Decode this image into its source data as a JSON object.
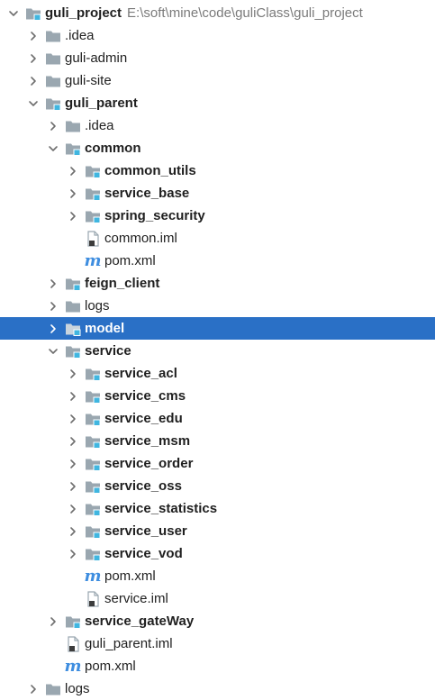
{
  "tree": [
    {
      "label": "guli_project",
      "path": "E:\\soft\\mine\\code\\guliClass\\guli_project",
      "icon": "module-folder-icon",
      "bold": true,
      "expanded": true,
      "depth": 0,
      "arrow": "down"
    },
    {
      "label": ".idea",
      "icon": "folder-icon",
      "bold": false,
      "depth": 1,
      "arrow": "right"
    },
    {
      "label": "guli-admin",
      "icon": "folder-icon",
      "bold": false,
      "depth": 1,
      "arrow": "right"
    },
    {
      "label": "guli-site",
      "icon": "folder-icon",
      "bold": false,
      "depth": 1,
      "arrow": "right"
    },
    {
      "label": "guli_parent",
      "icon": "module-folder-icon",
      "bold": true,
      "depth": 1,
      "arrow": "down"
    },
    {
      "label": ".idea",
      "icon": "folder-icon",
      "bold": false,
      "depth": 2,
      "arrow": "right"
    },
    {
      "label": "common",
      "icon": "module-folder-icon",
      "bold": true,
      "depth": 2,
      "arrow": "down"
    },
    {
      "label": "common_utils",
      "icon": "module-folder-icon",
      "bold": true,
      "depth": 3,
      "arrow": "right"
    },
    {
      "label": "service_base",
      "icon": "module-folder-icon",
      "bold": true,
      "depth": 3,
      "arrow": "right"
    },
    {
      "label": "spring_security",
      "icon": "module-folder-icon",
      "bold": true,
      "depth": 3,
      "arrow": "right"
    },
    {
      "label": "common.iml",
      "icon": "iml-file-icon",
      "bold": false,
      "depth": 3,
      "arrow": "none"
    },
    {
      "label": "pom.xml",
      "icon": "maven-icon",
      "bold": false,
      "depth": 3,
      "arrow": "none"
    },
    {
      "label": "feign_client",
      "icon": "module-folder-icon",
      "bold": true,
      "depth": 2,
      "arrow": "right"
    },
    {
      "label": "logs",
      "icon": "folder-icon",
      "bold": false,
      "depth": 2,
      "arrow": "right"
    },
    {
      "label": "model",
      "icon": "module-folder-icon",
      "bold": true,
      "depth": 2,
      "arrow": "right",
      "selected": true
    },
    {
      "label": "service",
      "icon": "module-folder-icon",
      "bold": true,
      "depth": 2,
      "arrow": "down"
    },
    {
      "label": "service_acl",
      "icon": "module-folder-icon",
      "bold": true,
      "depth": 3,
      "arrow": "right"
    },
    {
      "label": "service_cms",
      "icon": "module-folder-icon",
      "bold": true,
      "depth": 3,
      "arrow": "right"
    },
    {
      "label": "service_edu",
      "icon": "module-folder-icon",
      "bold": true,
      "depth": 3,
      "arrow": "right"
    },
    {
      "label": "service_msm",
      "icon": "module-folder-icon",
      "bold": true,
      "depth": 3,
      "arrow": "right"
    },
    {
      "label": "service_order",
      "icon": "module-folder-icon",
      "bold": true,
      "depth": 3,
      "arrow": "right"
    },
    {
      "label": "service_oss",
      "icon": "module-folder-icon",
      "bold": true,
      "depth": 3,
      "arrow": "right"
    },
    {
      "label": "service_statistics",
      "icon": "module-folder-icon",
      "bold": true,
      "depth": 3,
      "arrow": "right"
    },
    {
      "label": "service_user",
      "icon": "module-folder-icon",
      "bold": true,
      "depth": 3,
      "arrow": "right"
    },
    {
      "label": "service_vod",
      "icon": "module-folder-icon",
      "bold": true,
      "depth": 3,
      "arrow": "right"
    },
    {
      "label": "pom.xml",
      "icon": "maven-icon",
      "bold": false,
      "depth": 3,
      "arrow": "none"
    },
    {
      "label": "service.iml",
      "icon": "iml-file-icon",
      "bold": false,
      "depth": 3,
      "arrow": "none"
    },
    {
      "label": "service_gateWay",
      "icon": "module-folder-icon",
      "bold": true,
      "depth": 2,
      "arrow": "right"
    },
    {
      "label": "guli_parent.iml",
      "icon": "iml-file-icon",
      "bold": false,
      "depth": 2,
      "arrow": "none"
    },
    {
      "label": "pom.xml",
      "icon": "maven-icon",
      "bold": false,
      "depth": 2,
      "arrow": "none"
    },
    {
      "label": "logs",
      "icon": "folder-icon",
      "bold": false,
      "depth": 1,
      "arrow": "right"
    }
  ],
  "colors": {
    "folder": "#9aa7b0",
    "module_marker": "#40b6e0",
    "selection": "#2a70c6",
    "arrow": "#6e6e6e",
    "maven": "#3f8ee0"
  }
}
